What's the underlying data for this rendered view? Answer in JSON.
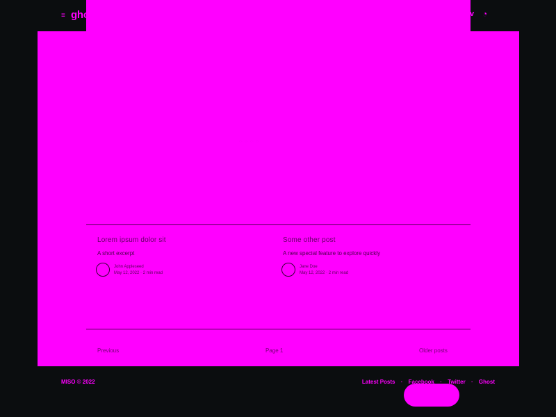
{
  "header": {
    "logo_icon": "≡",
    "logo_text": "ghost",
    "right_link": "v",
    "rss_icon": "rss-icon"
  },
  "hero": {
    "faint_text": "- - - -"
  },
  "posts": [
    {
      "title": "Lorem ipsum dolor sit",
      "excerpt": "A short excerpt",
      "author_name": "John Appleseed",
      "meta": "May 12, 2022 · 2 min read"
    },
    {
      "title": "Some other post",
      "excerpt": "A new special feature to explore quickly",
      "author_name": "Jane Doe",
      "meta": "May 12, 2022 · 2 min read"
    }
  ],
  "pagination": {
    "left": "Previous",
    "center": "Page 1",
    "right": "Older posts"
  },
  "footer": {
    "copyright": "MISO © 2022",
    "links": [
      "Latest Posts",
      "Facebook",
      "Twitter",
      "Ghost"
    ],
    "separator": "·"
  },
  "colors": {
    "background": "#0b0d0f",
    "accent": "#ff00ff"
  }
}
